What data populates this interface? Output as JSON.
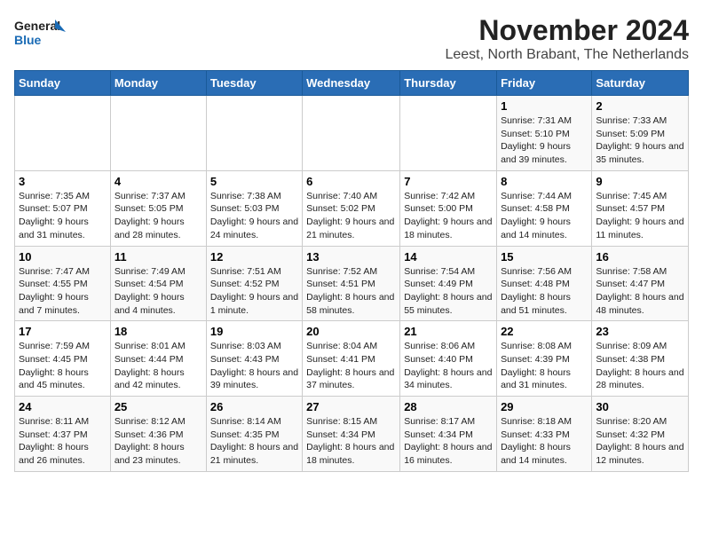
{
  "logo": {
    "line1": "General",
    "line2": "Blue"
  },
  "title": "November 2024",
  "subtitle": "Leest, North Brabant, The Netherlands",
  "days_of_week": [
    "Sunday",
    "Monday",
    "Tuesday",
    "Wednesday",
    "Thursday",
    "Friday",
    "Saturday"
  ],
  "weeks": [
    [
      {
        "day": "",
        "info": ""
      },
      {
        "day": "",
        "info": ""
      },
      {
        "day": "",
        "info": ""
      },
      {
        "day": "",
        "info": ""
      },
      {
        "day": "",
        "info": ""
      },
      {
        "day": "1",
        "info": "Sunrise: 7:31 AM\nSunset: 5:10 PM\nDaylight: 9 hours and 39 minutes."
      },
      {
        "day": "2",
        "info": "Sunrise: 7:33 AM\nSunset: 5:09 PM\nDaylight: 9 hours and 35 minutes."
      }
    ],
    [
      {
        "day": "3",
        "info": "Sunrise: 7:35 AM\nSunset: 5:07 PM\nDaylight: 9 hours and 31 minutes."
      },
      {
        "day": "4",
        "info": "Sunrise: 7:37 AM\nSunset: 5:05 PM\nDaylight: 9 hours and 28 minutes."
      },
      {
        "day": "5",
        "info": "Sunrise: 7:38 AM\nSunset: 5:03 PM\nDaylight: 9 hours and 24 minutes."
      },
      {
        "day": "6",
        "info": "Sunrise: 7:40 AM\nSunset: 5:02 PM\nDaylight: 9 hours and 21 minutes."
      },
      {
        "day": "7",
        "info": "Sunrise: 7:42 AM\nSunset: 5:00 PM\nDaylight: 9 hours and 18 minutes."
      },
      {
        "day": "8",
        "info": "Sunrise: 7:44 AM\nSunset: 4:58 PM\nDaylight: 9 hours and 14 minutes."
      },
      {
        "day": "9",
        "info": "Sunrise: 7:45 AM\nSunset: 4:57 PM\nDaylight: 9 hours and 11 minutes."
      }
    ],
    [
      {
        "day": "10",
        "info": "Sunrise: 7:47 AM\nSunset: 4:55 PM\nDaylight: 9 hours and 7 minutes."
      },
      {
        "day": "11",
        "info": "Sunrise: 7:49 AM\nSunset: 4:54 PM\nDaylight: 9 hours and 4 minutes."
      },
      {
        "day": "12",
        "info": "Sunrise: 7:51 AM\nSunset: 4:52 PM\nDaylight: 9 hours and 1 minute."
      },
      {
        "day": "13",
        "info": "Sunrise: 7:52 AM\nSunset: 4:51 PM\nDaylight: 8 hours and 58 minutes."
      },
      {
        "day": "14",
        "info": "Sunrise: 7:54 AM\nSunset: 4:49 PM\nDaylight: 8 hours and 55 minutes."
      },
      {
        "day": "15",
        "info": "Sunrise: 7:56 AM\nSunset: 4:48 PM\nDaylight: 8 hours and 51 minutes."
      },
      {
        "day": "16",
        "info": "Sunrise: 7:58 AM\nSunset: 4:47 PM\nDaylight: 8 hours and 48 minutes."
      }
    ],
    [
      {
        "day": "17",
        "info": "Sunrise: 7:59 AM\nSunset: 4:45 PM\nDaylight: 8 hours and 45 minutes."
      },
      {
        "day": "18",
        "info": "Sunrise: 8:01 AM\nSunset: 4:44 PM\nDaylight: 8 hours and 42 minutes."
      },
      {
        "day": "19",
        "info": "Sunrise: 8:03 AM\nSunset: 4:43 PM\nDaylight: 8 hours and 39 minutes."
      },
      {
        "day": "20",
        "info": "Sunrise: 8:04 AM\nSunset: 4:41 PM\nDaylight: 8 hours and 37 minutes."
      },
      {
        "day": "21",
        "info": "Sunrise: 8:06 AM\nSunset: 4:40 PM\nDaylight: 8 hours and 34 minutes."
      },
      {
        "day": "22",
        "info": "Sunrise: 8:08 AM\nSunset: 4:39 PM\nDaylight: 8 hours and 31 minutes."
      },
      {
        "day": "23",
        "info": "Sunrise: 8:09 AM\nSunset: 4:38 PM\nDaylight: 8 hours and 28 minutes."
      }
    ],
    [
      {
        "day": "24",
        "info": "Sunrise: 8:11 AM\nSunset: 4:37 PM\nDaylight: 8 hours and 26 minutes."
      },
      {
        "day": "25",
        "info": "Sunrise: 8:12 AM\nSunset: 4:36 PM\nDaylight: 8 hours and 23 minutes."
      },
      {
        "day": "26",
        "info": "Sunrise: 8:14 AM\nSunset: 4:35 PM\nDaylight: 8 hours and 21 minutes."
      },
      {
        "day": "27",
        "info": "Sunrise: 8:15 AM\nSunset: 4:34 PM\nDaylight: 8 hours and 18 minutes."
      },
      {
        "day": "28",
        "info": "Sunrise: 8:17 AM\nSunset: 4:34 PM\nDaylight: 8 hours and 16 minutes."
      },
      {
        "day": "29",
        "info": "Sunrise: 8:18 AM\nSunset: 4:33 PM\nDaylight: 8 hours and 14 minutes."
      },
      {
        "day": "30",
        "info": "Sunrise: 8:20 AM\nSunset: 4:32 PM\nDaylight: 8 hours and 12 minutes."
      }
    ]
  ]
}
